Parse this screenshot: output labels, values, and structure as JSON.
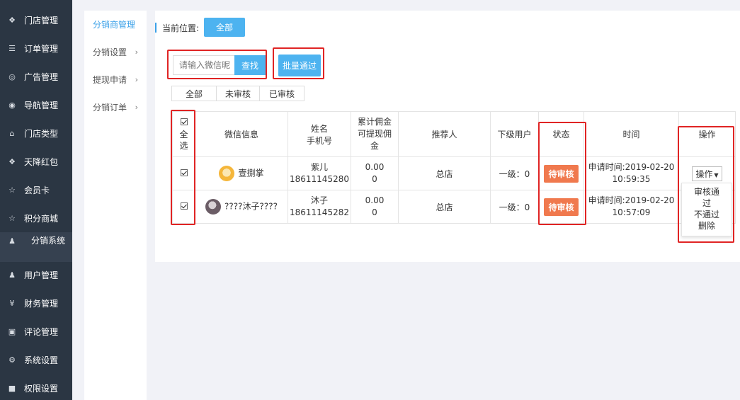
{
  "sidebar": {
    "items": [
      {
        "label": "门店管理",
        "icon": "cubes-icon",
        "glyph": "❖"
      },
      {
        "label": "订单管理",
        "icon": "list-icon",
        "glyph": "☰"
      },
      {
        "label": "广告管理",
        "icon": "lifebuoy-icon",
        "glyph": "◎"
      },
      {
        "label": "导航管理",
        "icon": "compass-icon",
        "glyph": "◉"
      },
      {
        "label": "门店类型",
        "icon": "bank-icon",
        "glyph": "⌂"
      },
      {
        "label": "天降红包",
        "icon": "cubes-icon",
        "glyph": "❖"
      },
      {
        "label": "会员卡",
        "icon": "star-icon",
        "glyph": "☆"
      },
      {
        "label": "积分商城",
        "icon": "star-icon",
        "glyph": "☆"
      },
      {
        "label": "分销系统",
        "icon": "users-icon",
        "glyph": "♟"
      },
      {
        "label": "用户管理",
        "icon": "user-icon",
        "glyph": "♟"
      },
      {
        "label": "财务管理",
        "icon": "yen-icon",
        "glyph": "¥"
      },
      {
        "label": "评论管理",
        "icon": "money-icon",
        "glyph": "▣"
      },
      {
        "label": "系统设置",
        "icon": "gear-icon",
        "glyph": "⚙"
      },
      {
        "label": "权限设置",
        "icon": "lock-icon",
        "glyph": "■"
      }
    ]
  },
  "submenu": {
    "items": [
      {
        "label": "分销商管理",
        "chevron": ""
      },
      {
        "label": "分销设置",
        "chevron": "›"
      },
      {
        "label": "提现申请",
        "chevron": "›"
      },
      {
        "label": "分销订单",
        "chevron": "›"
      }
    ]
  },
  "breadcrumb": {
    "label": "当前位置:",
    "button": "全部"
  },
  "search": {
    "placeholder": "请输入微信昵",
    "button": "查找"
  },
  "batch_button": "批量通过",
  "tabs": [
    "全部",
    "未审核",
    "已审核"
  ],
  "table": {
    "headers": {
      "select_all": "全选",
      "wechat": "微信信息",
      "name": "姓名",
      "phone": "手机号",
      "commission_line1": "累计佣金",
      "commission_line2": "可提现佣",
      "commission_line3": "金",
      "referrer": "推荐人",
      "subordinates": "下级用户",
      "status": "状态",
      "time": "时间",
      "action": "操作"
    },
    "rows": [
      {
        "nickname": "壹捌掌",
        "name": "紫儿",
        "phone": "18611145280",
        "total": "0.00",
        "withdrawable": "0",
        "referrer": "总店",
        "sub": "一级：0",
        "status": "待审核",
        "time_line1": "申请时间:2019-02-20",
        "time_line2": "10:59:35",
        "action": "操作"
      },
      {
        "nickname": "????沐子????",
        "name": "沐子",
        "phone": "18611145282",
        "total": "0.00",
        "withdrawable": "0",
        "referrer": "总店",
        "sub": "一级：0",
        "status": "待审核",
        "time_line1": "申请时间:2019-02-20",
        "time_line2": "10:57:09",
        "action": ""
      }
    ]
  },
  "dropdown": {
    "approve_line1": "审核通",
    "approve_line2": "过",
    "reject": "不通过",
    "delete": "删除"
  },
  "colors": {
    "sidebar_bg": "#2b3643",
    "accent_blue": "#4db3f0",
    "badge_orange": "#f0794e",
    "highlight_red": "#e02424"
  }
}
